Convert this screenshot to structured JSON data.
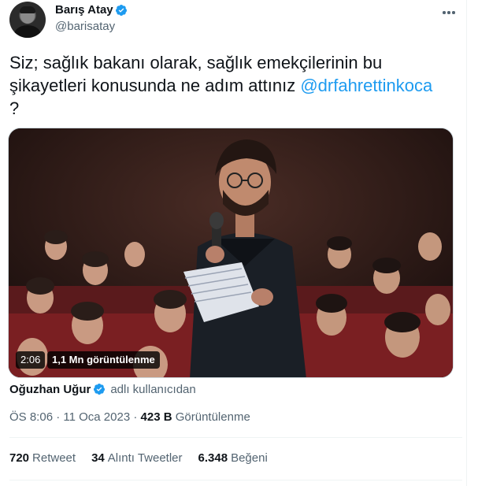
{
  "author": {
    "display_name": "Barış Atay",
    "handle": "@barisatay"
  },
  "tweet": {
    "text_before": "Siz; sağlık bakanı olarak, sağlık emekçilerinin bu şikayetleri konusunda ne adım attınız ",
    "mention": "@drfahrettinkoca",
    "text_after": "?"
  },
  "media": {
    "duration": "2:06",
    "views": "1,1 Mn görüntülenme"
  },
  "credit": {
    "name": "Oğuzhan Uğur",
    "suffix": "adlı kullanıcıdan"
  },
  "meta": {
    "time": "ÖS 8:06",
    "separator": " · ",
    "date": "11 Oca 2023",
    "views_count": "423 B",
    "views_label": "Görüntülenme"
  },
  "stats": {
    "retweets_count": "720",
    "retweets_label": "Retweet",
    "quotes_count": "34",
    "quotes_label": "Alıntı Tweetler",
    "likes_count": "6.348",
    "likes_label": "Beğeni"
  },
  "colors": {
    "accent": "#1d9bf0",
    "secondary_text": "#536471",
    "primary_text": "#0f1419"
  }
}
